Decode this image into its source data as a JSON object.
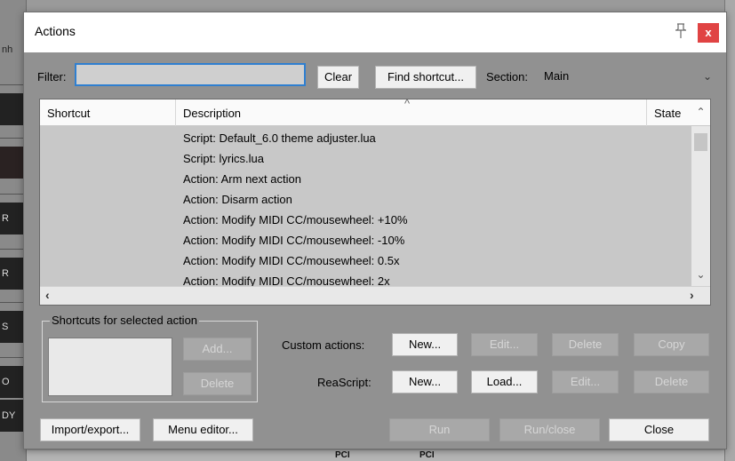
{
  "background": {
    "left_labels": [
      "nh",
      "R",
      "R",
      "S",
      "O",
      "DY"
    ],
    "bottom_labels": [
      "PCI",
      "PCI"
    ]
  },
  "dialog": {
    "title": "Actions",
    "close_label": "x"
  },
  "filter": {
    "label": "Filter:",
    "value": "",
    "clear_label": "Clear",
    "find_shortcut_label": "Find shortcut...",
    "section_label": "Section:",
    "section_value": "Main"
  },
  "list": {
    "columns": [
      "Shortcut",
      "Description",
      "State"
    ],
    "rows": [
      "Script: Default_6.0 theme adjuster.lua",
      "Script: lyrics.lua",
      "Action: Arm next action",
      "Action: Disarm action",
      "Action: Modify MIDI CC/mousewheel: +10%",
      "Action: Modify MIDI CC/mousewheel: -10%",
      "Action: Modify MIDI CC/mousewheel: 0.5x",
      "Action: Modify MIDI CC/mousewheel: 2x"
    ]
  },
  "shortcuts_group": {
    "legend": "Shortcuts for selected action",
    "add_label": "Add...",
    "delete_label": "Delete"
  },
  "custom_actions": {
    "label": "Custom actions:",
    "new_label": "New...",
    "edit_label": "Edit...",
    "delete_label": "Delete",
    "copy_label": "Copy"
  },
  "reascript": {
    "label": "ReaScript:",
    "new_label": "New...",
    "load_label": "Load...",
    "edit_label": "Edit...",
    "delete_label": "Delete"
  },
  "footer": {
    "import_export_label": "Import/export...",
    "menu_editor_label": "Menu editor...",
    "run_label": "Run",
    "run_close_label": "Run/close",
    "close_label": "Close"
  },
  "colors": {
    "dialog_bg": "#919191",
    "close_button": "#e04343",
    "focus_border": "#2f7fd0"
  }
}
